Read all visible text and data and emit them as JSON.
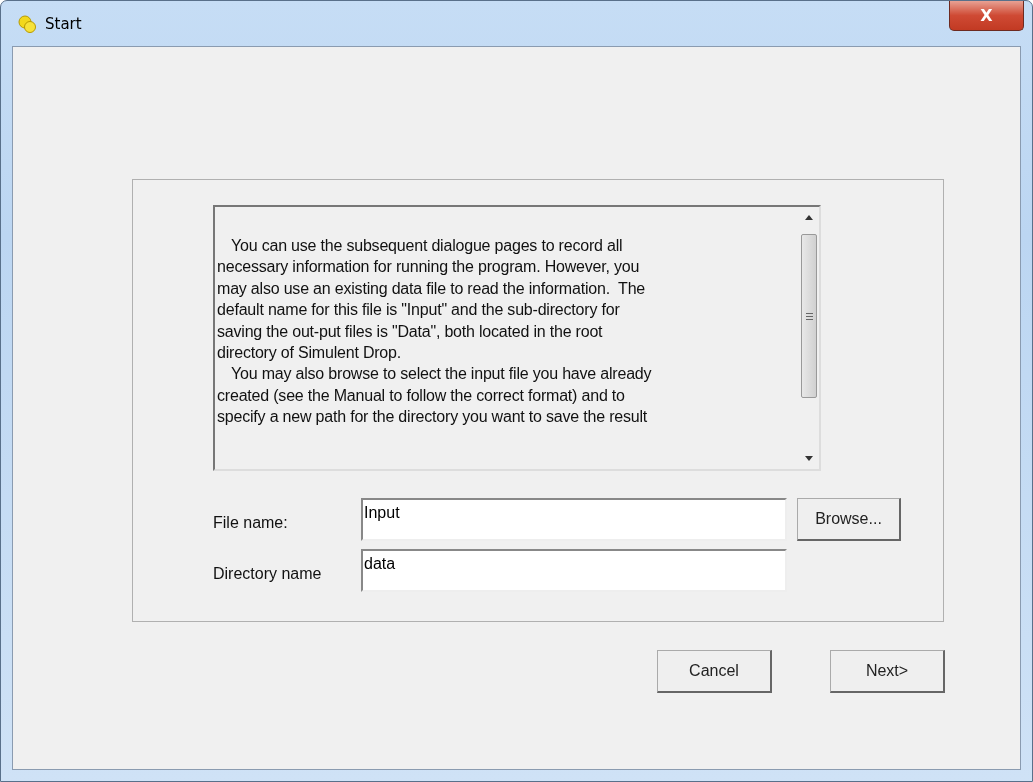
{
  "window": {
    "title": "Start",
    "close_label": "X"
  },
  "info_text": {
    "paragraphs": [
      "You can use the subsequent dialogue pages to record all\nnecessary information for running the program. However, you\nmay also use an existing data file to read the information.  The\ndefault name for this file is \"Input\" and the sub-directory for\nsaving the out-put files is \"Data\", both located in the root\ndirectory of Simulent Drop.",
      "You may also browse to select the input file you have already\ncreated (see the Manual to follow the correct format) and to\nspecify a new path for the directory you want to save the result"
    ]
  },
  "fields": [
    {
      "label": "File name:",
      "value": "Input"
    },
    {
      "label": "Directory name",
      "value": "data"
    }
  ],
  "browse_button": "Browse...",
  "buttons": [
    "Cancel",
    "Next>"
  ]
}
